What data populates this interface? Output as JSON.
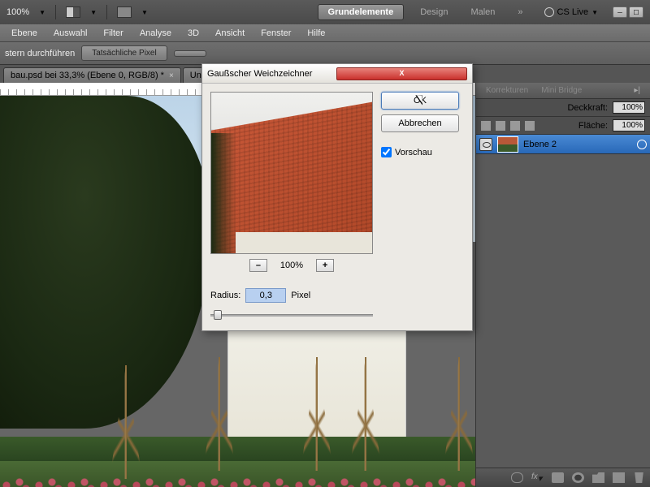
{
  "topbar": {
    "zoom": "100%",
    "ws_active": "Grundelemente",
    "ws2": "Design",
    "ws3": "Malen",
    "more": "»",
    "cslive": "CS Live"
  },
  "menu": [
    "Ebene",
    "Auswahl",
    "Filter",
    "Analyse",
    "3D",
    "Ansicht",
    "Fenster",
    "Hilfe"
  ],
  "optbar": {
    "label1": "stern durchführen",
    "btn1": "Tatsächliche Pixel"
  },
  "tabs": {
    "t1": "bau.psd bei 33,3% (Ebene 0, RGB/8) *",
    "t2": "Un"
  },
  "panels": {
    "tab1": "Korrekturen",
    "tab2": "Mini Bridge",
    "opacity_lbl": "Deckkraft:",
    "opacity_val": "100%",
    "fill_lbl": "Fläche:",
    "fill_val": "100%",
    "layer_name": "Ebene 2"
  },
  "dialog": {
    "title": "Gaußscher Weichzeichner",
    "ok": "OK",
    "cancel": "Abbrechen",
    "preview_chk": "Vorschau",
    "zoom_pct": "100%",
    "minus": "–",
    "plus": "+",
    "radius_lbl": "Radius:",
    "radius_val": "0,3",
    "pixel_lbl": "Pixel"
  }
}
